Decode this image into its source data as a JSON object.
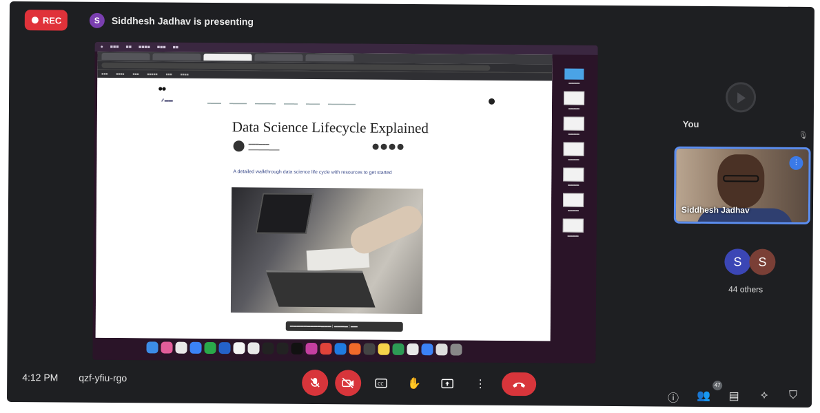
{
  "recording": {
    "label": "REC"
  },
  "presenter": {
    "initial": "S",
    "status_text": "Siddhesh Jadhav is presenting"
  },
  "shared_screen": {
    "article_title": "Data Science Lifecycle Explained",
    "article_subtitle": "A detailed walkthrough data science life cycle with resources to get started"
  },
  "self_tile": {
    "label": "You"
  },
  "presenter_tile": {
    "name": "Siddhesh Jadhav"
  },
  "participants": {
    "avatars": [
      "S",
      "S"
    ],
    "others_label": "44 others",
    "count_badge": "47"
  },
  "bottom_bar": {
    "time": "4:12 PM",
    "meeting_code": "qzf-yfiu-rgo"
  },
  "colors": {
    "background": "#1e1f22",
    "accent_red": "#d8353b",
    "accent_blue": "#5b8def"
  },
  "icons": {
    "mic_off": "mic-off-icon",
    "camera_off": "camera-off-icon",
    "captions": "captions-icon",
    "raise_hand": "raise-hand-icon",
    "present": "present-screen-icon",
    "more": "more-options-icon",
    "end_call": "end-call-icon",
    "info": "info-icon",
    "people": "people-icon",
    "chat": "chat-icon",
    "activities": "activities-icon",
    "host_controls": "host-controls-icon"
  }
}
